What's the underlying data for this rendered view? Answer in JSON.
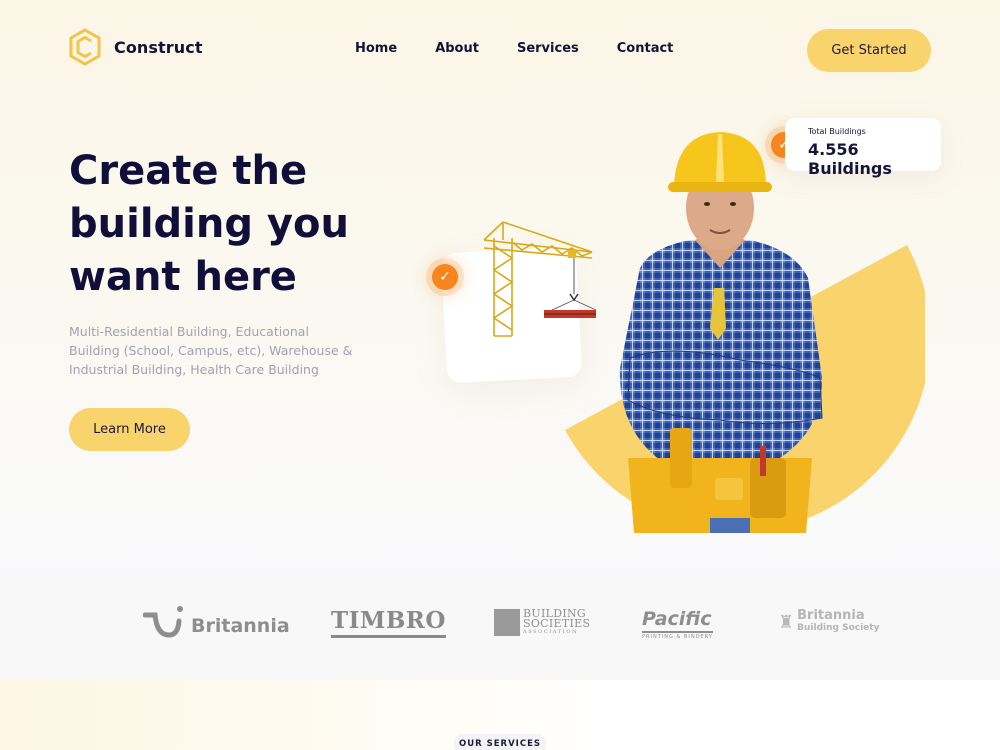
{
  "brand": {
    "name": "Construct"
  },
  "nav": {
    "items": [
      "Home",
      "About",
      "Services",
      "Contact"
    ]
  },
  "header": {
    "cta_label": "Get Started"
  },
  "hero": {
    "title_lines": [
      "Create the",
      "building you",
      "want here"
    ],
    "description": "Multi-Residential Building, Educational Building (School, Campus, etc), Warehouse & Industrial Building, Health Care Building",
    "button_label": "Learn More"
  },
  "stats": {
    "label": "Total Buildings",
    "value": "4.556 Buildings"
  },
  "partners": {
    "britannia": "Britannia",
    "timbro": "TIMBRO",
    "building_societies": [
      "BUILDING",
      "SOCIETIES",
      "ASSOCIATION"
    ],
    "pacific": {
      "name": "Pacific",
      "tag": "PRINTING & BINDERY"
    },
    "britannia_bs": [
      "Britannia",
      "Building Society"
    ]
  },
  "services": {
    "eyebrow": "OUR SERVICES"
  },
  "colors": {
    "accent_yellow": "#f9d36c",
    "accent_orange": "#f7851c",
    "navy": "#0f0f3a"
  }
}
